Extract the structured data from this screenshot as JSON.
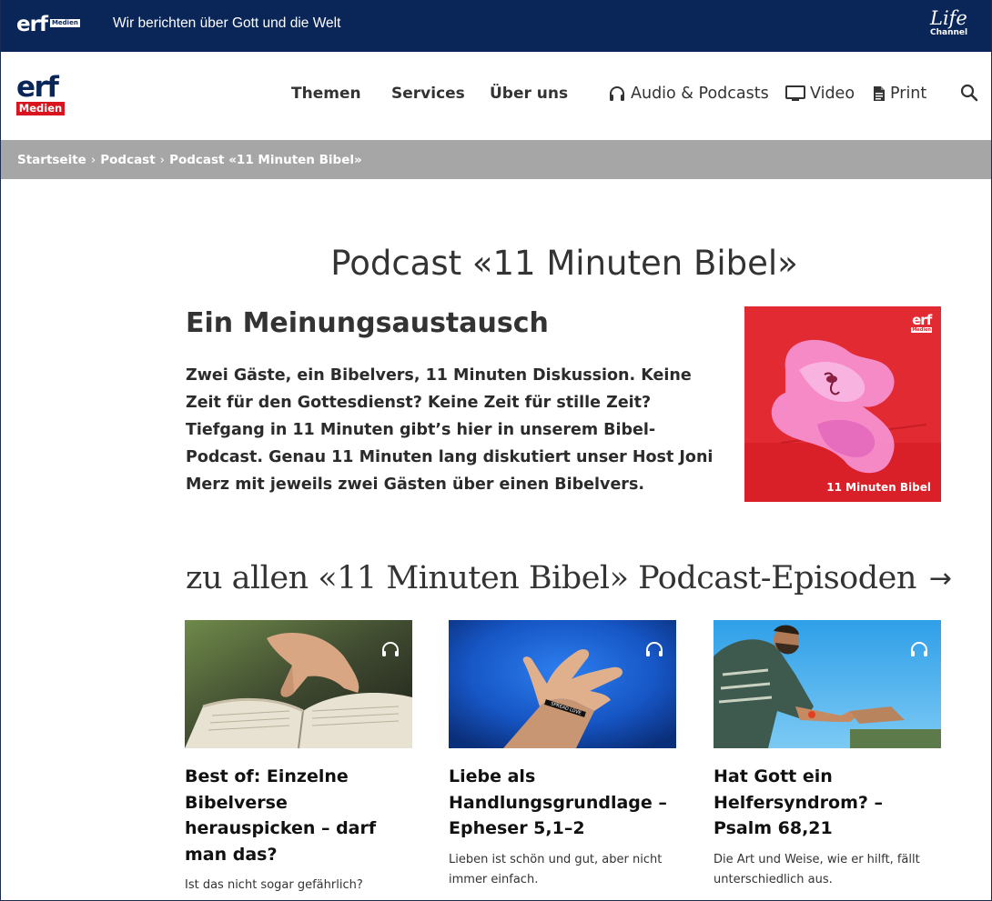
{
  "topbar": {
    "logo_text": "erf",
    "logo_badge": "Medien",
    "tagline": "Wir berichten über Gott und die Welt",
    "life_word": "Life",
    "channel_word": "Channel"
  },
  "header": {
    "logo_text": "erf",
    "logo_badge": "Medien",
    "nav": [
      "Themen",
      "Services",
      "Über uns"
    ],
    "secondary": [
      {
        "label": "Audio & Podcasts",
        "icon": "headphones-icon"
      },
      {
        "label": "Video",
        "icon": "monitor-icon"
      },
      {
        "label": "Print",
        "icon": "document-icon"
      }
    ],
    "search_icon": "search-icon"
  },
  "breadcrumb": [
    "Startseite",
    "Podcast",
    "Podcast «11 Minuten Bibel»"
  ],
  "breadcrumb_separator": "›",
  "main": {
    "title": "Podcast «11 Minuten Bibel»",
    "subtitle": "Ein Meinungsaustausch",
    "intro": "Zwei Gäste, ein Bibelvers, 11 Minuten Diskussion. Keine Zeit für den Gottesdienst? Keine Zeit für stille Zeit? Tiefgang in 11 Minuten gibt’s hier in unserem Bibel-Podcast. Genau 11 Minuten lang diskutiert unser Host Joni Merz mit jeweils zwei Gästen über einen Bibelvers.",
    "cover": {
      "logo_text": "erf",
      "logo_badge": "Medien",
      "caption": "11 Minuten Bibel"
    },
    "all_episodes_link": "zu allen «11 Minuten Bibel» Podcast-Episoden",
    "arrow": "→"
  },
  "cards": [
    {
      "title": "Best of: Einzelne Bibelverse herauspicken – darf man das?",
      "desc": "Ist das nicht sogar gefährlich?"
    },
    {
      "title": "Liebe als Handlungsgrundlage – Epheser 5,1–2",
      "desc": "Lieben ist schön und gut, aber nicht immer einfach."
    },
    {
      "title": "Hat Gott ein Helfersyndrom? – Psalm 68,21",
      "desc": "Die Art und Weise, wie er hilft, fällt unterschiedlich aus."
    }
  ],
  "colors": {
    "topbar": "#0a2558",
    "brand_red": "#d9141e",
    "breadcrumb_bg": "#a6a6a6",
    "cover_red": "#e8262e"
  }
}
